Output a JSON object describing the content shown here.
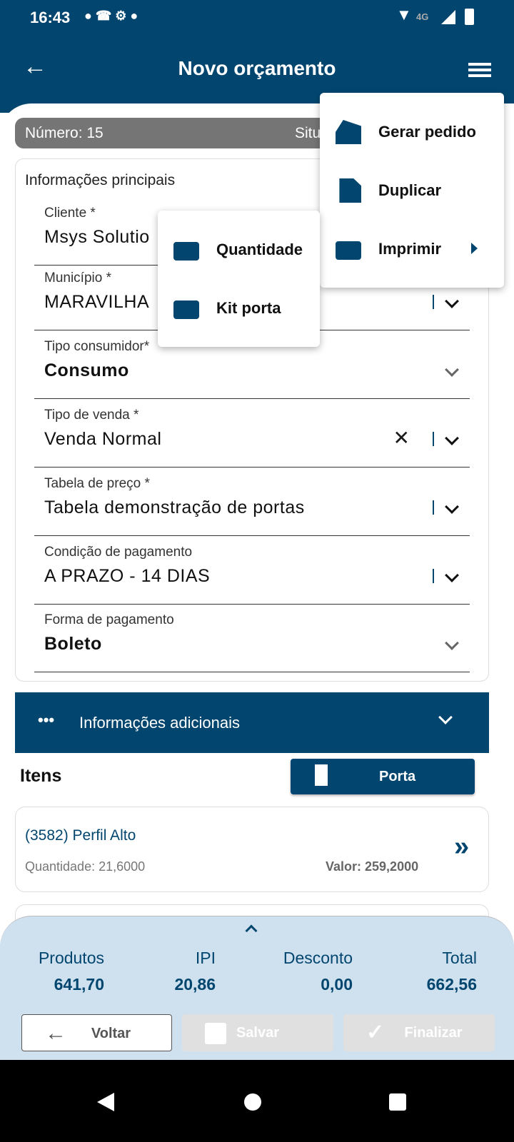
{
  "status_bar": {
    "time": "16:43",
    "network": "4G"
  },
  "app_bar": {
    "title": "Novo orçamento",
    "back_icon": "arrow-left-icon",
    "menu_icon": "list-icon"
  },
  "header": {
    "number": "Número: 15",
    "situation": "Situ"
  },
  "main": {
    "section_title": "Informações principais",
    "fields": [
      {
        "label": "Cliente *",
        "value": "Msys Solutio"
      },
      {
        "label": "Município *",
        "value": "MARAVILHA"
      },
      {
        "label": "Tipo consumidor*",
        "value": "Consumo"
      },
      {
        "label": "Tipo de venda *",
        "value": "Venda Normal"
      },
      {
        "label": "Tabela de preço *",
        "value": "Tabela demonstração de portas"
      },
      {
        "label": "Condição de pagamento",
        "value": "A PRAZO - 14 DIAS"
      },
      {
        "label": "Forma de pagamento",
        "value": "Boleto"
      }
    ]
  },
  "additional": {
    "label": "Informações adicionais"
  },
  "items": {
    "title": "Itens",
    "door_button": "Porta",
    "list": [
      {
        "name": "(3582) Perfil Alto",
        "quantity": "Quantidade: 21,6000",
        "value": "Valor: 259,2000"
      }
    ]
  },
  "totals": [
    {
      "label": "Produtos",
      "value": "641,70"
    },
    {
      "label": "IPI",
      "value": "20,86"
    },
    {
      "label": "Desconto",
      "value": "0,00"
    },
    {
      "label": "Total",
      "value": "662,56"
    }
  ],
  "actions": {
    "back": "Voltar",
    "save": "Salvar",
    "finish": "Finalizar"
  },
  "menu": {
    "items": [
      {
        "label": "Gerar pedido",
        "icon": "order-icon"
      },
      {
        "label": "Duplicar",
        "icon": "copy-icon"
      },
      {
        "label": "Imprimir",
        "icon": "printer-icon"
      }
    ]
  },
  "submenu": {
    "items": [
      {
        "label": "Quantidade",
        "icon": "printer-icon"
      },
      {
        "label": "Kit porta",
        "icon": "printer-icon"
      }
    ]
  },
  "colors": {
    "primary": "#02466f",
    "panel": "#cfe0ef"
  }
}
